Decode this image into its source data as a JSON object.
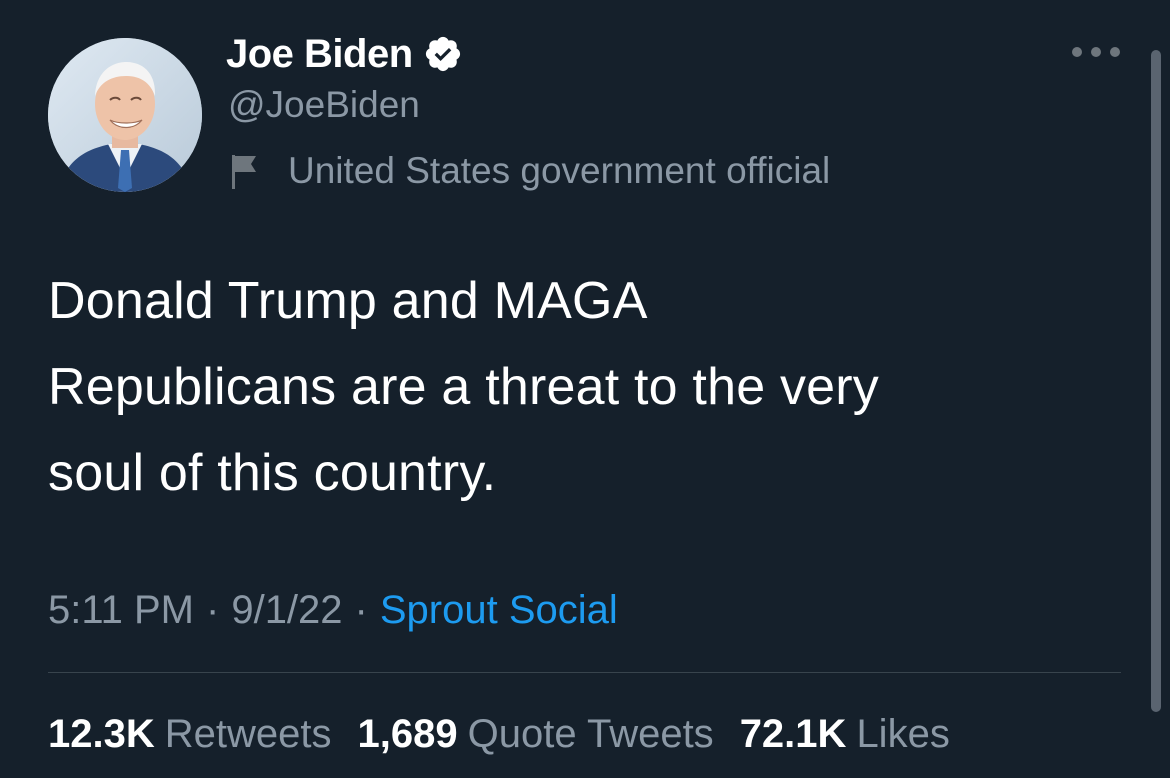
{
  "author": {
    "display_name": "Joe Biden",
    "handle": "@JoeBiden",
    "verified_icon": "verified-badge-icon",
    "label": "United States government official",
    "label_icon": "flag-icon",
    "avatar": "profile-photo"
  },
  "tweet": {
    "text": "Donald Trump and MAGA\nRepublicans are a threat to the very\nsoul of this country.",
    "time": "5:11 PM",
    "date": "9/1/22",
    "separator": "·",
    "source": "Sprout Social"
  },
  "stats": {
    "retweets": {
      "count": "12.3K",
      "label": "Retweets"
    },
    "quote_tweets": {
      "count": "1,689",
      "label": "Quote Tweets"
    },
    "likes": {
      "count": "72.1K",
      "label": "Likes"
    }
  },
  "colors": {
    "background": "#15202b",
    "secondary_text": "#8b98a5",
    "accent": "#1d9bf0",
    "divider": "#38444d"
  },
  "menu_icon": "more-options-icon"
}
